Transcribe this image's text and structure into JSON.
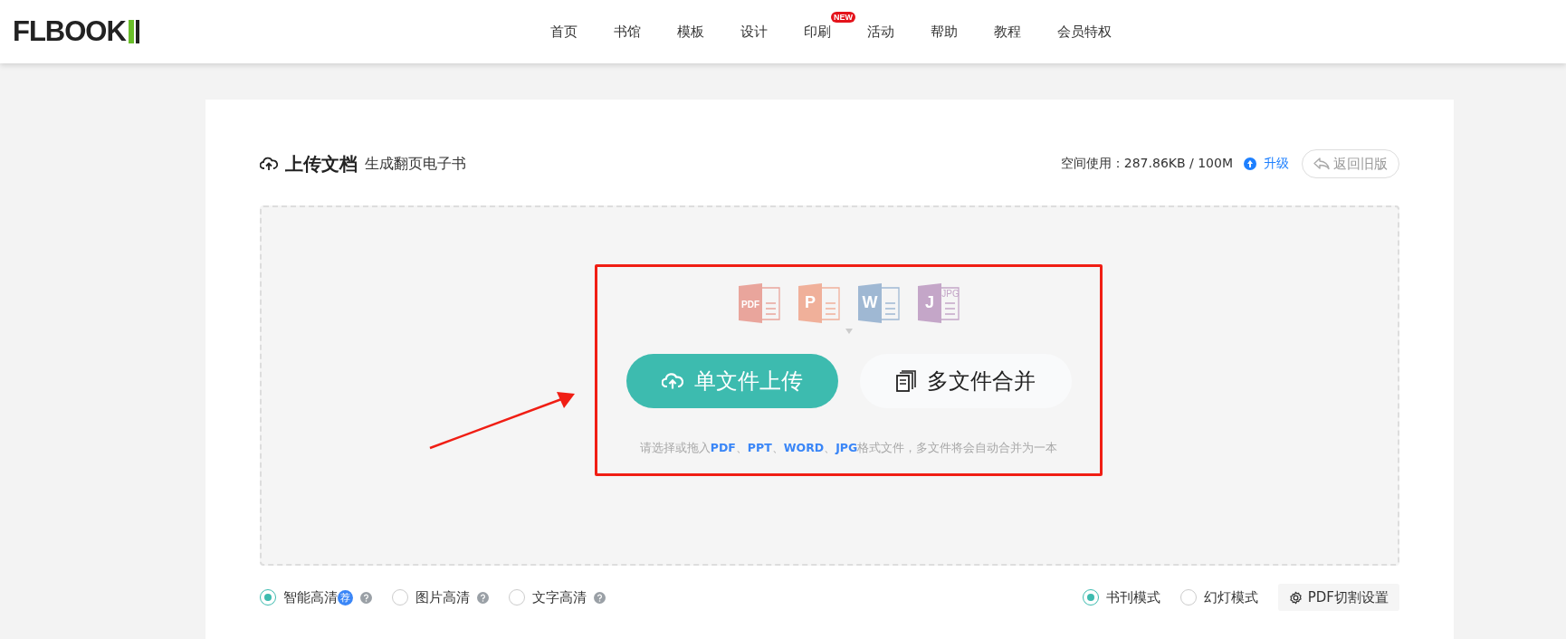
{
  "header": {
    "logo": "FLBOOK",
    "nav": [
      {
        "label": "首页"
      },
      {
        "label": "书馆"
      },
      {
        "label": "模板"
      },
      {
        "label": "设计"
      },
      {
        "label": "印刷",
        "badge": "NEW"
      },
      {
        "label": "活动"
      },
      {
        "label": "帮助"
      },
      {
        "label": "教程"
      },
      {
        "label": "会员特权"
      }
    ]
  },
  "upload": {
    "title": "上传文档",
    "subtitle": "生成翻页电子书",
    "usage": "空间使用：287.86KB / 100M",
    "upgrade": "升级",
    "old_version": "返回旧版",
    "file_types": [
      {
        "badge": "PDF",
        "color": "#e9a59c"
      },
      {
        "badge": "P",
        "color": "#f0b09a"
      },
      {
        "badge": "W",
        "color": "#9fb8d3"
      },
      {
        "badge": "J",
        "sub": "JPG",
        "color": "#c4a6c8"
      }
    ],
    "single_button": "单文件上传",
    "multi_button": "多文件合并",
    "hint": "请选择或拖入**PDF**、**PPT**、**WORD**、**JPG**格式文件，多文件将会自动合并为一本",
    "quality": [
      {
        "label": "智能高清",
        "tag": "荐",
        "selected": true
      },
      {
        "label": "图片高清",
        "selected": false
      },
      {
        "label": "文字高清",
        "selected": false
      }
    ],
    "modes": [
      {
        "label": "书刊模式",
        "selected": true
      },
      {
        "label": "幻灯模式",
        "selected": false
      }
    ],
    "split_settings": "PDF切割设置"
  }
}
